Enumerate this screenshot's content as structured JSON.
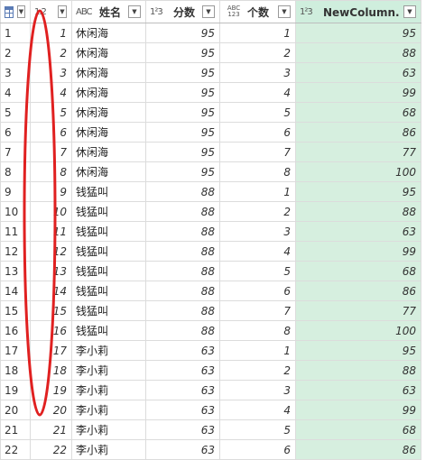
{
  "columns": [
    {
      "label": "",
      "type": "table",
      "name": "row-selector-header"
    },
    {
      "label": "",
      "type": "1.2",
      "name": "col-header-number"
    },
    {
      "label": "姓名",
      "type": "ABC",
      "name": "col-header-name"
    },
    {
      "label": "分数",
      "type": "123",
      "name": "col-header-score"
    },
    {
      "label": "个数",
      "type": "ABC/123",
      "name": "col-header-count"
    },
    {
      "label": "NewColumn.分...",
      "type": "123",
      "name": "col-header-newcolumn"
    }
  ],
  "type_labels": {
    "t12": "1.2",
    "tabc": "AB",
    "tabc2": "C",
    "t123": "1²3",
    "tabc123a": "ABC",
    "tabc123b": "123"
  },
  "rows": [
    {
      "idx": "1",
      "num": "1",
      "name": "休闲海",
      "score": "95",
      "count": "1",
      "newcol": "95"
    },
    {
      "idx": "2",
      "num": "2",
      "name": "休闲海",
      "score": "95",
      "count": "2",
      "newcol": "88"
    },
    {
      "idx": "3",
      "num": "3",
      "name": "休闲海",
      "score": "95",
      "count": "3",
      "newcol": "63"
    },
    {
      "idx": "4",
      "num": "4",
      "name": "休闲海",
      "score": "95",
      "count": "4",
      "newcol": "99"
    },
    {
      "idx": "5",
      "num": "5",
      "name": "休闲海",
      "score": "95",
      "count": "5",
      "newcol": "68"
    },
    {
      "idx": "6",
      "num": "6",
      "name": "休闲海",
      "score": "95",
      "count": "6",
      "newcol": "86"
    },
    {
      "idx": "7",
      "num": "7",
      "name": "休闲海",
      "score": "95",
      "count": "7",
      "newcol": "77"
    },
    {
      "idx": "8",
      "num": "8",
      "name": "休闲海",
      "score": "95",
      "count": "8",
      "newcol": "100"
    },
    {
      "idx": "9",
      "num": "9",
      "name": "钱猛叫",
      "score": "88",
      "count": "1",
      "newcol": "95"
    },
    {
      "idx": "10",
      "num": "10",
      "name": "钱猛叫",
      "score": "88",
      "count": "2",
      "newcol": "88"
    },
    {
      "idx": "11",
      "num": "11",
      "name": "钱猛叫",
      "score": "88",
      "count": "3",
      "newcol": "63"
    },
    {
      "idx": "12",
      "num": "12",
      "name": "钱猛叫",
      "score": "88",
      "count": "4",
      "newcol": "99"
    },
    {
      "idx": "13",
      "num": "13",
      "name": "钱猛叫",
      "score": "88",
      "count": "5",
      "newcol": "68"
    },
    {
      "idx": "14",
      "num": "14",
      "name": "钱猛叫",
      "score": "88",
      "count": "6",
      "newcol": "86"
    },
    {
      "idx": "15",
      "num": "15",
      "name": "钱猛叫",
      "score": "88",
      "count": "7",
      "newcol": "77"
    },
    {
      "idx": "16",
      "num": "16",
      "name": "钱猛叫",
      "score": "88",
      "count": "8",
      "newcol": "100"
    },
    {
      "idx": "17",
      "num": "17",
      "name": "李小莉",
      "score": "63",
      "count": "1",
      "newcol": "95"
    },
    {
      "idx": "18",
      "num": "18",
      "name": "李小莉",
      "score": "63",
      "count": "2",
      "newcol": "88"
    },
    {
      "idx": "19",
      "num": "19",
      "name": "李小莉",
      "score": "63",
      "count": "3",
      "newcol": "63"
    },
    {
      "idx": "20",
      "num": "20",
      "name": "李小莉",
      "score": "63",
      "count": "4",
      "newcol": "99"
    },
    {
      "idx": "21",
      "num": "21",
      "name": "李小莉",
      "score": "63",
      "count": "5",
      "newcol": "68"
    },
    {
      "idx": "22",
      "num": "22",
      "name": "李小莉",
      "score": "63",
      "count": "6",
      "newcol": "86"
    }
  ],
  "colors": {
    "highlight_column": "#d6efdf",
    "annotation": "#e02020"
  }
}
